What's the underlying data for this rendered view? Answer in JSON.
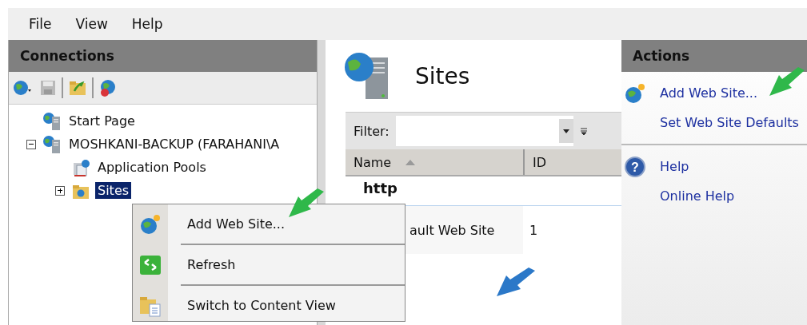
{
  "menu_bar": [
    "File",
    "View",
    "Help"
  ],
  "connections": {
    "title": "Connections",
    "tree": [
      {
        "label": "Start Page",
        "selected": false
      },
      {
        "label": "MOSHKANI-BACKUP (FARAHANI\\A",
        "selected": false,
        "expanded": true,
        "children": [
          {
            "label": "Application Pools",
            "selected": false
          },
          {
            "label": "Sites",
            "selected": true,
            "expanded": false
          }
        ]
      }
    ]
  },
  "content": {
    "title": "Sites",
    "filter": {
      "label": "Filter:"
    },
    "columns": [
      "Name",
      "ID"
    ],
    "group": "http",
    "rows": [
      {
        "name": "ault Web Site",
        "id": "1"
      }
    ]
  },
  "context_menu": [
    {
      "kind": "add",
      "label": "Add Web Site..."
    },
    {
      "kind": "refresh",
      "label": "Refresh"
    },
    {
      "kind": "switch",
      "label": "Switch to Content View"
    }
  ],
  "actions": {
    "title": "Actions",
    "help_icon": "?",
    "groups": [
      [
        "Add Web Site...",
        "Set Web Site Defaults"
      ],
      [
        "Help",
        "Online Help"
      ]
    ]
  }
}
